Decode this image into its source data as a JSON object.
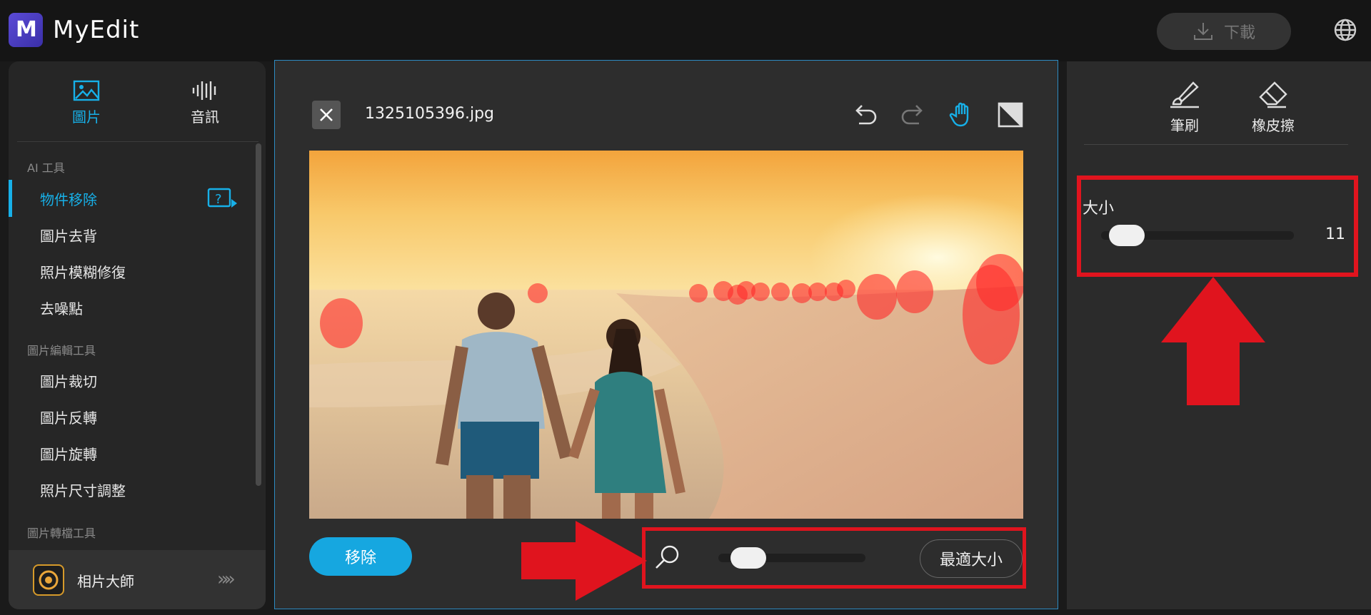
{
  "header": {
    "logo_letter": "M",
    "app_name": "MyEdit",
    "download_label": "下載",
    "download_icon": "download-icon",
    "language_icon": "globe-icon"
  },
  "sidebar": {
    "tabs": [
      {
        "label": "圖片",
        "icon": "image-icon",
        "active": true
      },
      {
        "label": "音訊",
        "icon": "audio-wave-icon",
        "active": false
      }
    ],
    "sections": [
      {
        "title": "AI 工具",
        "items": [
          "物件移除",
          "圖片去背",
          "照片模糊修復",
          "去噪點"
        ]
      },
      {
        "title": "圖片編輯工具",
        "items": [
          "圖片裁切",
          "圖片反轉",
          "圖片旋轉",
          "照片尺寸調整"
        ]
      },
      {
        "title": "圖片轉檔工具",
        "items": []
      }
    ],
    "active_item": "物件移除",
    "footer": {
      "label": "相片大師",
      "icon": "photodirector-icon",
      "chevron": "»»"
    }
  },
  "editor": {
    "filename": "1325105396.jpg",
    "toolbar": [
      "undo-icon",
      "redo-icon",
      "hand-icon",
      "compare-icon"
    ],
    "remove_label": "移除",
    "zoom_level": 0.12,
    "fit_label": "最適大小"
  },
  "right_panel": {
    "tools": [
      {
        "label": "筆刷",
        "icon": "brush-icon"
      },
      {
        "label": "橡皮擦",
        "icon": "eraser-icon"
      }
    ],
    "size": {
      "label": "大小",
      "value": "11",
      "level": 0.05
    }
  },
  "colors": {
    "accent": "#17b0e8",
    "highlight": "#e0141e",
    "mask": "#ff2a2a"
  }
}
